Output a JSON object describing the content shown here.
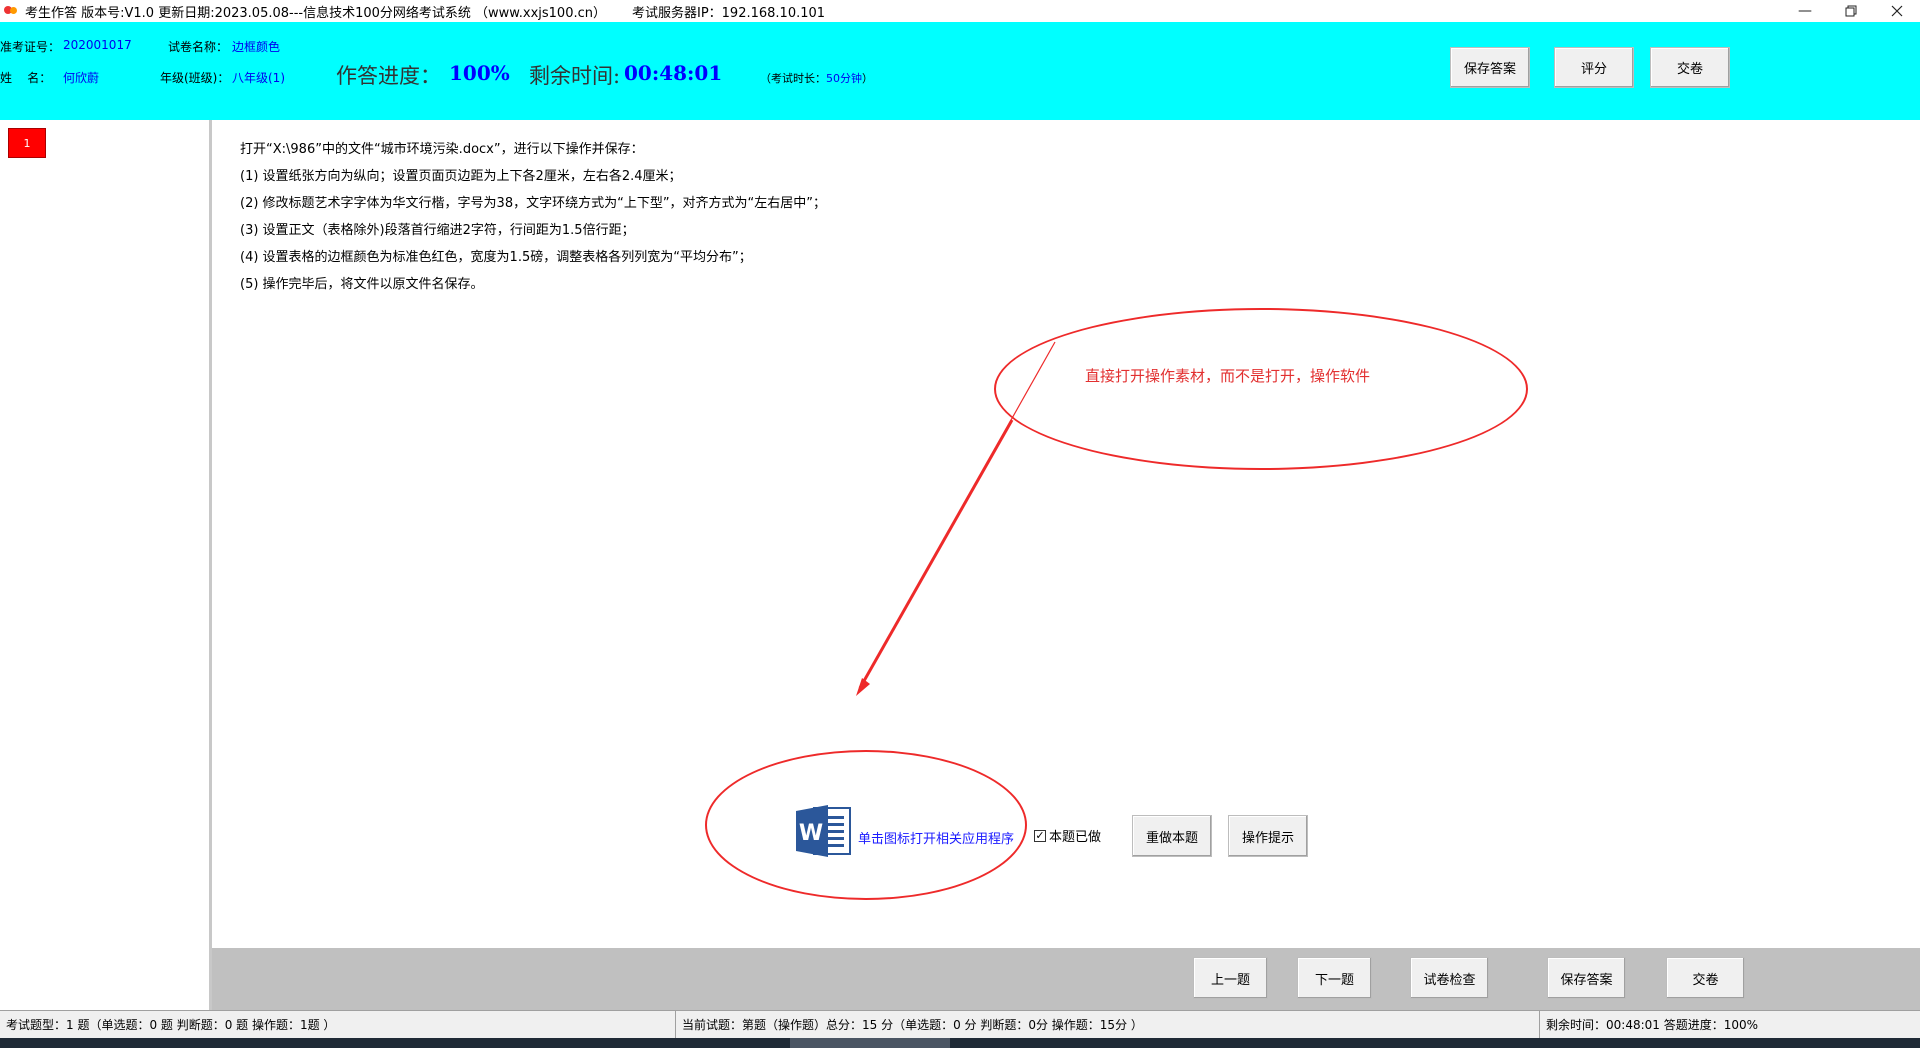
{
  "titlebar": {
    "app_title": "考生作答 版本号:V1.0 更新日期:2023.05.08---信息技术100分网络考试系统 （www.xxjs100.cn）",
    "server": "考试服务器IP：192.168.10.101",
    "minimize_icon": "minimize-icon",
    "restore_icon": "restore-icon",
    "close_icon": "close-icon"
  },
  "header": {
    "exam_id_label": "准考证号：",
    "exam_id": "202001017",
    "paper_label": "试卷名称：",
    "paper_name": "边框颜色",
    "name_label": "姓    名：",
    "name": "何欣蔚",
    "grade_label": "年级(班级)：",
    "grade": "八年级(1)",
    "progress_label": "作答进度：",
    "progress_value": "100%",
    "time_label": "剩余时间:",
    "time_value": "00:48:01",
    "duration_prefix": "（考试时长：",
    "duration_value": "50分钟",
    "duration_suffix": "）",
    "save_button": "保存答案",
    "score_button": "评分",
    "submit_button": "交卷"
  },
  "left_panel": {
    "questions": [
      {
        "number": "1",
        "status": "current"
      }
    ]
  },
  "question": {
    "lines": [
      "打开“X:\\986”中的文件“城市环境污染.docx”，进行以下操作并保存：",
      "(1)  设置纸张方向为纵向；设置页面页边距为上下各2厘米，左右各2.4厘米；",
      "(2) 修改标题艺术字字体为华文行楷，字号为38，文字环绕方式为“上下型”，对齐方式为“左右居中”；",
      "(3) 设置正文（表格除外)段落首行缩进2字符，行间距为1.5倍行距；",
      "(4)  设置表格的边框颜色为标准色红色，宽度为1.5磅，调整表格各列列宽为“平均分布”；",
      "(5) 操作完毕后，将文件以原文件名保存。"
    ],
    "annotation_text": "直接打开操作素材，而不是打开，操作软件",
    "open_app_label": "单击图标打开相关应用程序",
    "done_label": "本题已做",
    "done_checked": true,
    "redo_button": "重做本题",
    "hint_button": "操作提示",
    "annotation_color": "#ee2a2a"
  },
  "bottom_nav": {
    "prev_button": "上一题",
    "next_button": "下一题",
    "check_button": "试卷检查",
    "save_button": "保存答案",
    "submit_button": "交卷"
  },
  "statusbar": {
    "types": "考试题型：1 题（单选题：0 题 判断题：0 题 操作题：1题 ）",
    "current": "当前试题：第题（操作题）总分：15 分（单选题：0 分 判断题：0分 操作题：15分 ）",
    "remaining": "剩余时间：00:48:01 答题进度：100%"
  },
  "colors": {
    "header_bg": "#00ffff",
    "value_blue": "#0000ff",
    "current_question": "#ff0000"
  }
}
